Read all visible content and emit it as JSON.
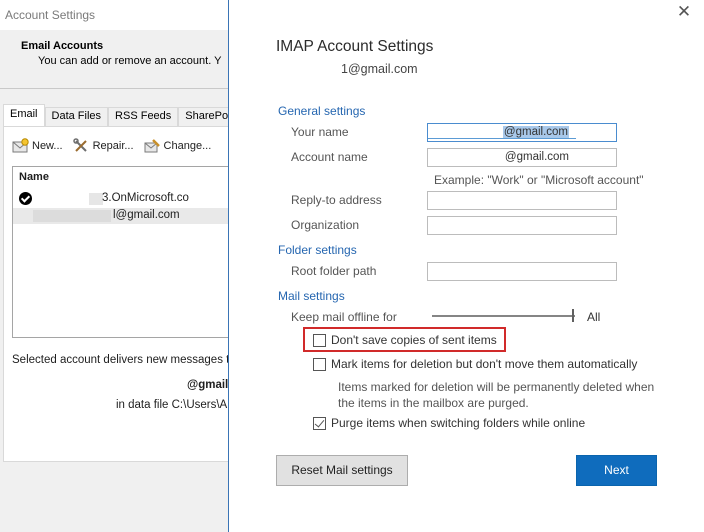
{
  "background_window": {
    "title": "Account Settings",
    "header_title": "Email Accounts",
    "header_desc": "You can add or remove an account. Y",
    "tabs": [
      {
        "label": "Email"
      },
      {
        "label": "Data Files"
      },
      {
        "label": "RSS Feeds"
      },
      {
        "label": "SharePoi"
      }
    ],
    "toolbar": {
      "new_label": "New...",
      "repair_label": "Repair...",
      "change_label": "Change..."
    },
    "list_header": "Name",
    "accounts": [
      {
        "name": "3.OnMicrosoft.co"
      },
      {
        "name": "l@gmail.com"
      }
    ],
    "deliver_label": "Selected account delivers new messages to",
    "deliver_account": "@gmail",
    "deliver_file": "in data file C:\\Users\\A"
  },
  "dialog": {
    "close_glyph": "✕",
    "title": "IMAP Account Settings",
    "email": "1@gmail.com",
    "general_section": "General settings",
    "your_name_label": "Your name",
    "your_name_value": "@gmail.com",
    "account_name_label": "Account name",
    "account_name_value": "@gmail.com",
    "hint": "Example: \"Work\" or \"Microsoft account\"",
    "reply_to_label": "Reply-to address",
    "reply_to_value": "",
    "organization_label": "Organization",
    "organization_value": "",
    "folder_section": "Folder settings",
    "root_folder_label": "Root folder path",
    "root_folder_value": "",
    "mail_section": "Mail settings",
    "offline_label": "Keep mail offline for",
    "offline_value": "All",
    "dont_save_label": "Don't save copies of sent items",
    "dont_save_checked": false,
    "mark_delete_label": "Mark items for deletion but don't move them automatically",
    "mark_delete_checked": false,
    "purge_note": "Items marked for deletion will be permanently deleted when the items in the mailbox are purged.",
    "purge_label": "Purge items when switching folders while online",
    "purge_checked": true,
    "reset_button": "Reset Mail settings",
    "next_button": "Next"
  },
  "colors": {
    "accent": "#0f6cbd",
    "section_heading": "#2566b0",
    "highlight": "#d12a2a"
  }
}
